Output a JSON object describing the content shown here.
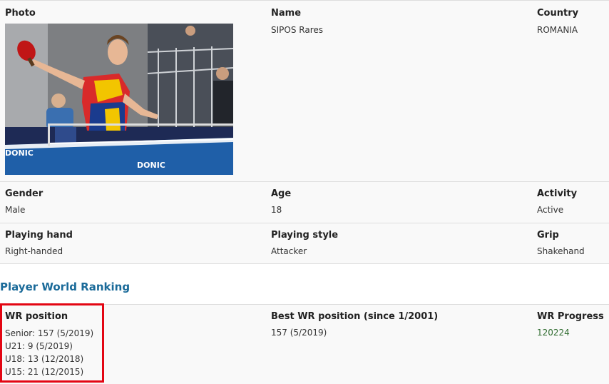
{
  "profile": {
    "photo_label": "Photo",
    "name_label": "Name",
    "name_value": "SIPOS Rares",
    "country_label": "Country",
    "country_value": "ROMANIA",
    "gender_label": "Gender",
    "gender_value": "Male",
    "age_label": "Age",
    "age_value": "18",
    "activity_label": "Activity",
    "activity_value": "Active",
    "hand_label": "Playing hand",
    "hand_value": "Right-handed",
    "style_label": "Playing style",
    "style_value": "Attacker",
    "grip_label": "Grip",
    "grip_value": "Shakehand"
  },
  "photo": {
    "table_brand": "DONIC"
  },
  "ranking": {
    "section_title": "Player World Ranking",
    "wr_label": "WR position",
    "wr_lines": [
      "Senior: 157 (5/2019)",
      "U21: 9 (5/2019)",
      "U18: 13 (12/2018)",
      "U15: 21 (12/2015)"
    ],
    "best_label": "Best WR position (since 1/2001)",
    "best_value": "157 (5/2019)",
    "progress_label": "WR Progress",
    "progress_link": "120224"
  },
  "colors": {
    "highlight": "#e30613",
    "section_title": "#1a6a99",
    "link": "#2e6b2e"
  }
}
